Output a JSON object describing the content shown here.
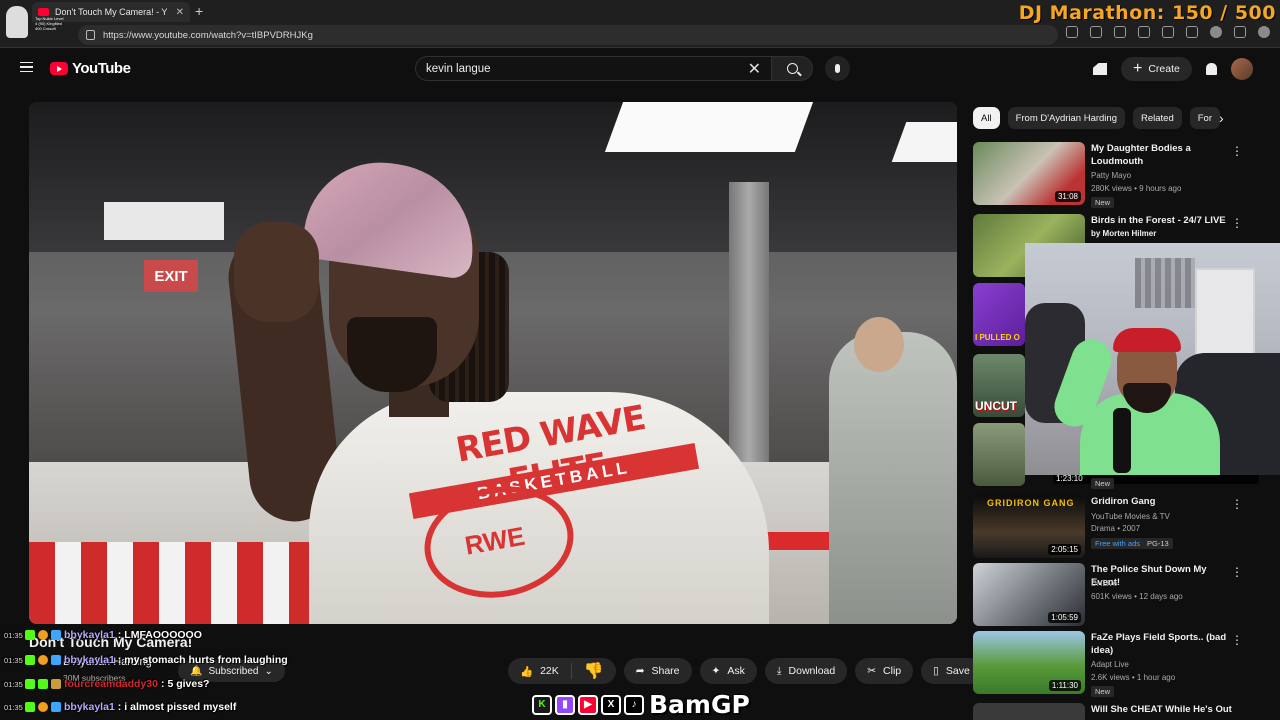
{
  "browser": {
    "tab_title": "Don't Touch My Camera! - Y",
    "tab_close": "✕",
    "new_tab": "+",
    "url": "https://www.youtube.com/watch?v=tIBPVDRHJKg",
    "overlay_logo_text": "Top Nukie Level 4 (90) Kingfiled 400 Crosoft"
  },
  "stream_overlay": {
    "marathon": "DJ Marathon:  150 ∕ 500",
    "socials_name": "BamGP",
    "social_icons": [
      "kick-icon",
      "twitch-icon",
      "youtube-icon",
      "x-icon",
      "tiktok-icon"
    ]
  },
  "header": {
    "logo_text": "YouTube",
    "search_value": "kevin langue",
    "create_label": "Create"
  },
  "video": {
    "title": "Don't Touch My Camera!",
    "channel": "D'Aydrian Harding",
    "subscribers": "30M subscribers",
    "subscribed_label": "Subscribed",
    "exit_sign": "EXIT",
    "shirt_text": "RED WAVE ELITE",
    "shirt_sub": "BASKETBALL",
    "shirt_logo": "RWE",
    "actions": {
      "likes": "22K",
      "share": "Share",
      "ask": "Ask",
      "download": "Download",
      "clip": "Clip",
      "save": "Save"
    }
  },
  "sidebar": {
    "chips": [
      "All",
      "From D'Aydrian Harding",
      "Related",
      "For"
    ],
    "recommendations": [
      {
        "title": "My Daughter Bodies a Loudmouth",
        "channel": "Patty Mayo",
        "meta": "280K views • 9 hours ago",
        "duration": "31:08",
        "badge": "New"
      },
      {
        "title": "Birds in the Forest - 24/7 LIVE",
        "channel": "by Morten Hilmer",
        "meta": "",
        "duration": "",
        "badge": ""
      },
      {
        "title": "",
        "channel": "",
        "meta": "",
        "duration": "",
        "badge": "",
        "thumb_text": "I PULLED O"
      },
      {
        "title": "",
        "channel": "",
        "meta": "",
        "duration": "",
        "badge": "",
        "thumb_text": "UNCUT"
      },
      {
        "title": "",
        "channel": "",
        "meta": "",
        "duration": "1:23:10",
        "badge": "New"
      },
      {
        "title": "Gridiron Gang",
        "channel": "YouTube Movies & TV",
        "meta": "Drama • 2007",
        "duration": "2:05:15",
        "badge": "Free with ads",
        "badge2": "PG-13",
        "thumb_text": "GRIDIRON GANG"
      },
      {
        "title": "The Police Shut Down My Event!",
        "channel": "DHLive",
        "meta": "601K views • 12 days ago",
        "duration": "1:05:59",
        "badge": ""
      },
      {
        "title": "FaZe Plays Field Sports.. (bad idea)",
        "channel": "Adapt Live",
        "meta": "2.6K views • 1 hour ago",
        "duration": "1:11:30",
        "badge": "New"
      },
      {
        "title": "Will She CHEAT While He's Out",
        "channel": "",
        "meta": "",
        "duration": "",
        "badge": ""
      }
    ]
  },
  "chat": [
    {
      "time": "01:35",
      "user": "bbykayla1",
      "text": "LMFAOOOOOO"
    },
    {
      "time": "01:35",
      "user": "bbykayla1",
      "text": "my stomach hurts from laughing"
    },
    {
      "time": "01:35",
      "user": "fourcreamdaddy30",
      "text": "5 gives?"
    },
    {
      "time": "01:35",
      "user": "bbykayla1",
      "text": "i almost pissed myself"
    }
  ],
  "colors": {
    "background": "#0f0f0f",
    "brand_red": "#ff0033",
    "marathon_orange": "#f5a623",
    "chat_user": "#b6a9ff"
  }
}
